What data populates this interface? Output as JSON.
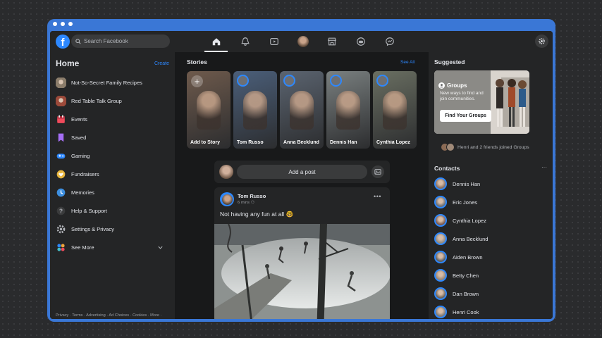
{
  "window": {
    "title": "Facebook"
  },
  "header": {
    "logo": "f",
    "search_placeholder": "Search Facebook",
    "nav_icons": [
      "home-icon",
      "groups-icon",
      "watch-icon",
      "profile-avatar",
      "marketplace-icon",
      "gaming-icon",
      "messenger-icon"
    ],
    "active_nav": "home-icon"
  },
  "sidebar": {
    "title": "Home",
    "create_label": "Create",
    "items": [
      {
        "label": "Not-So-Secret Family Recipes",
        "icon": "group-avatar",
        "color": "#8b7d6b"
      },
      {
        "label": "Red Table Talk Group",
        "icon": "group-avatar",
        "color": "#9c4a3a"
      },
      {
        "label": "Events",
        "icon": "calendar-icon",
        "color": "#f04a5b"
      },
      {
        "label": "Saved",
        "icon": "bookmark-icon",
        "color": "#a56ef5"
      },
      {
        "label": "Gaming",
        "icon": "gamepad-icon",
        "color": "#2d88ff"
      },
      {
        "label": "Fundraisers",
        "icon": "fundraiser-icon",
        "color": "#e8b53d"
      },
      {
        "label": "Memories",
        "icon": "clock-icon",
        "color": "#3d8fe0"
      },
      {
        "label": "Help & Support",
        "icon": "question-icon",
        "color": "#b0b3b8"
      },
      {
        "label": "Settings & Privacy",
        "icon": "gear-icon",
        "color": "#b0b3b8"
      },
      {
        "label": "See More",
        "icon": "more-icon",
        "color": "#2d88ff"
      }
    ],
    "footer": "Privacy · Terms · Advertising · Ad Choices · Cookies · More · Facebook © 2019"
  },
  "stories": {
    "title": "Stories",
    "see_all": "See All",
    "items": [
      {
        "name": "Add to Story",
        "bg": "#6e5a4c"
      },
      {
        "name": "Tom Russo",
        "bg": "#4b5f7a"
      },
      {
        "name": "Anna Becklund",
        "bg": "#5b6470"
      },
      {
        "name": "Dennis Han",
        "bg": "#7a8080"
      },
      {
        "name": "Cynthia Lopez",
        "bg": "#6a6f62"
      }
    ]
  },
  "composer": {
    "placeholder": "Add a post"
  },
  "post": {
    "author": "Tom Russo",
    "time": "6 mins",
    "text": "Not having any fun at all 🤓"
  },
  "suggested": {
    "title": "Suggested",
    "card_title": "Groups",
    "card_desc": "New ways to find and join communities.",
    "button": "Find Your Groups",
    "joined_text": "Henri and 2 friends joined Groups"
  },
  "contacts": {
    "title": "Contacts",
    "more": "···",
    "items": [
      {
        "name": "Dennis Han",
        "color": "#8a7060"
      },
      {
        "name": "Eric Jones",
        "color": "#6c6f74"
      },
      {
        "name": "Cynthia Lopez",
        "color": "#7b5b50"
      },
      {
        "name": "Anna Becklund",
        "color": "#8f8a84"
      },
      {
        "name": "Aiden Brown",
        "color": "#5d5f63"
      },
      {
        "name": "Betty Chen",
        "color": "#9b8776"
      },
      {
        "name": "Dan Brown",
        "color": "#6e6358"
      },
      {
        "name": "Henri Cook",
        "color": "#7d7a76"
      }
    ]
  }
}
